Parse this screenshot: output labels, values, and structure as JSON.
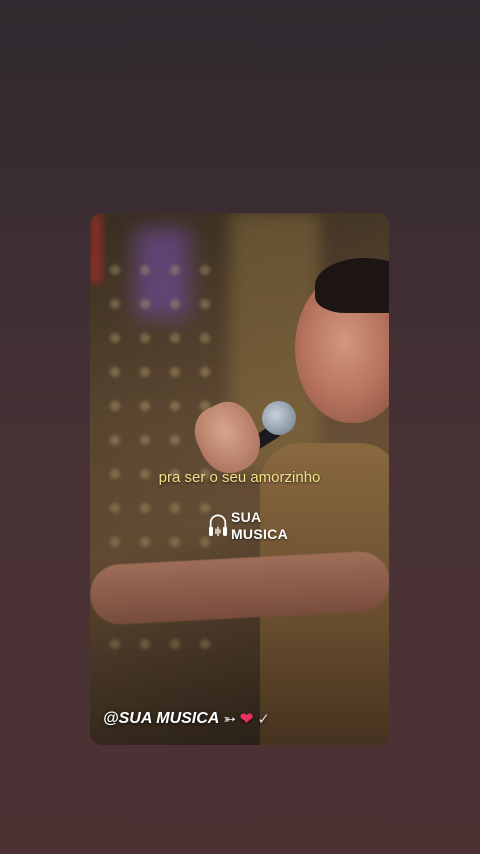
{
  "video": {
    "caption": "pra ser o seu amorzinho",
    "logo": {
      "line1": "SUA",
      "line2": "MUSICA"
    },
    "handle": "@SUA MUSICA",
    "emojis": {
      "arrow": "➳",
      "heart": "❤",
      "check": "✓"
    }
  }
}
